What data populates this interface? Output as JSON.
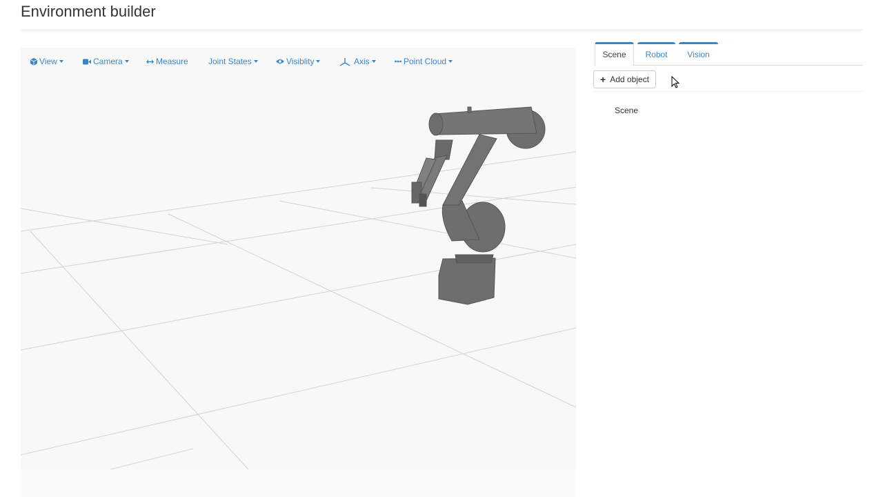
{
  "page": {
    "title": "Environment builder"
  },
  "viewer": {
    "toolbar": [
      {
        "label": "View",
        "icon": "cube-icon",
        "dropdown": true
      },
      {
        "label": "Camera",
        "icon": "video-camera-icon",
        "dropdown": true
      },
      {
        "label": "Measure",
        "icon": "arrows-horizontal-icon",
        "dropdown": false
      },
      {
        "label": "Joint States",
        "icon": "",
        "dropdown": true
      },
      {
        "label": "Visiblity",
        "icon": "eye-icon",
        "dropdown": true
      },
      {
        "label": "Axis",
        "icon": "axis-icon",
        "dropdown": true
      },
      {
        "label": "Point Cloud",
        "icon": "ellipsis-icon",
        "dropdown": true
      }
    ],
    "accent_color": "#3a87c8",
    "robot_color": "#6e6e6e"
  },
  "panel": {
    "tabs": [
      {
        "label": "Scene",
        "active": true
      },
      {
        "label": "Robot",
        "active": false
      },
      {
        "label": "Vision",
        "active": false
      }
    ],
    "add_object_label": "Add object",
    "tree": [
      {
        "label": "Scene"
      }
    ]
  }
}
